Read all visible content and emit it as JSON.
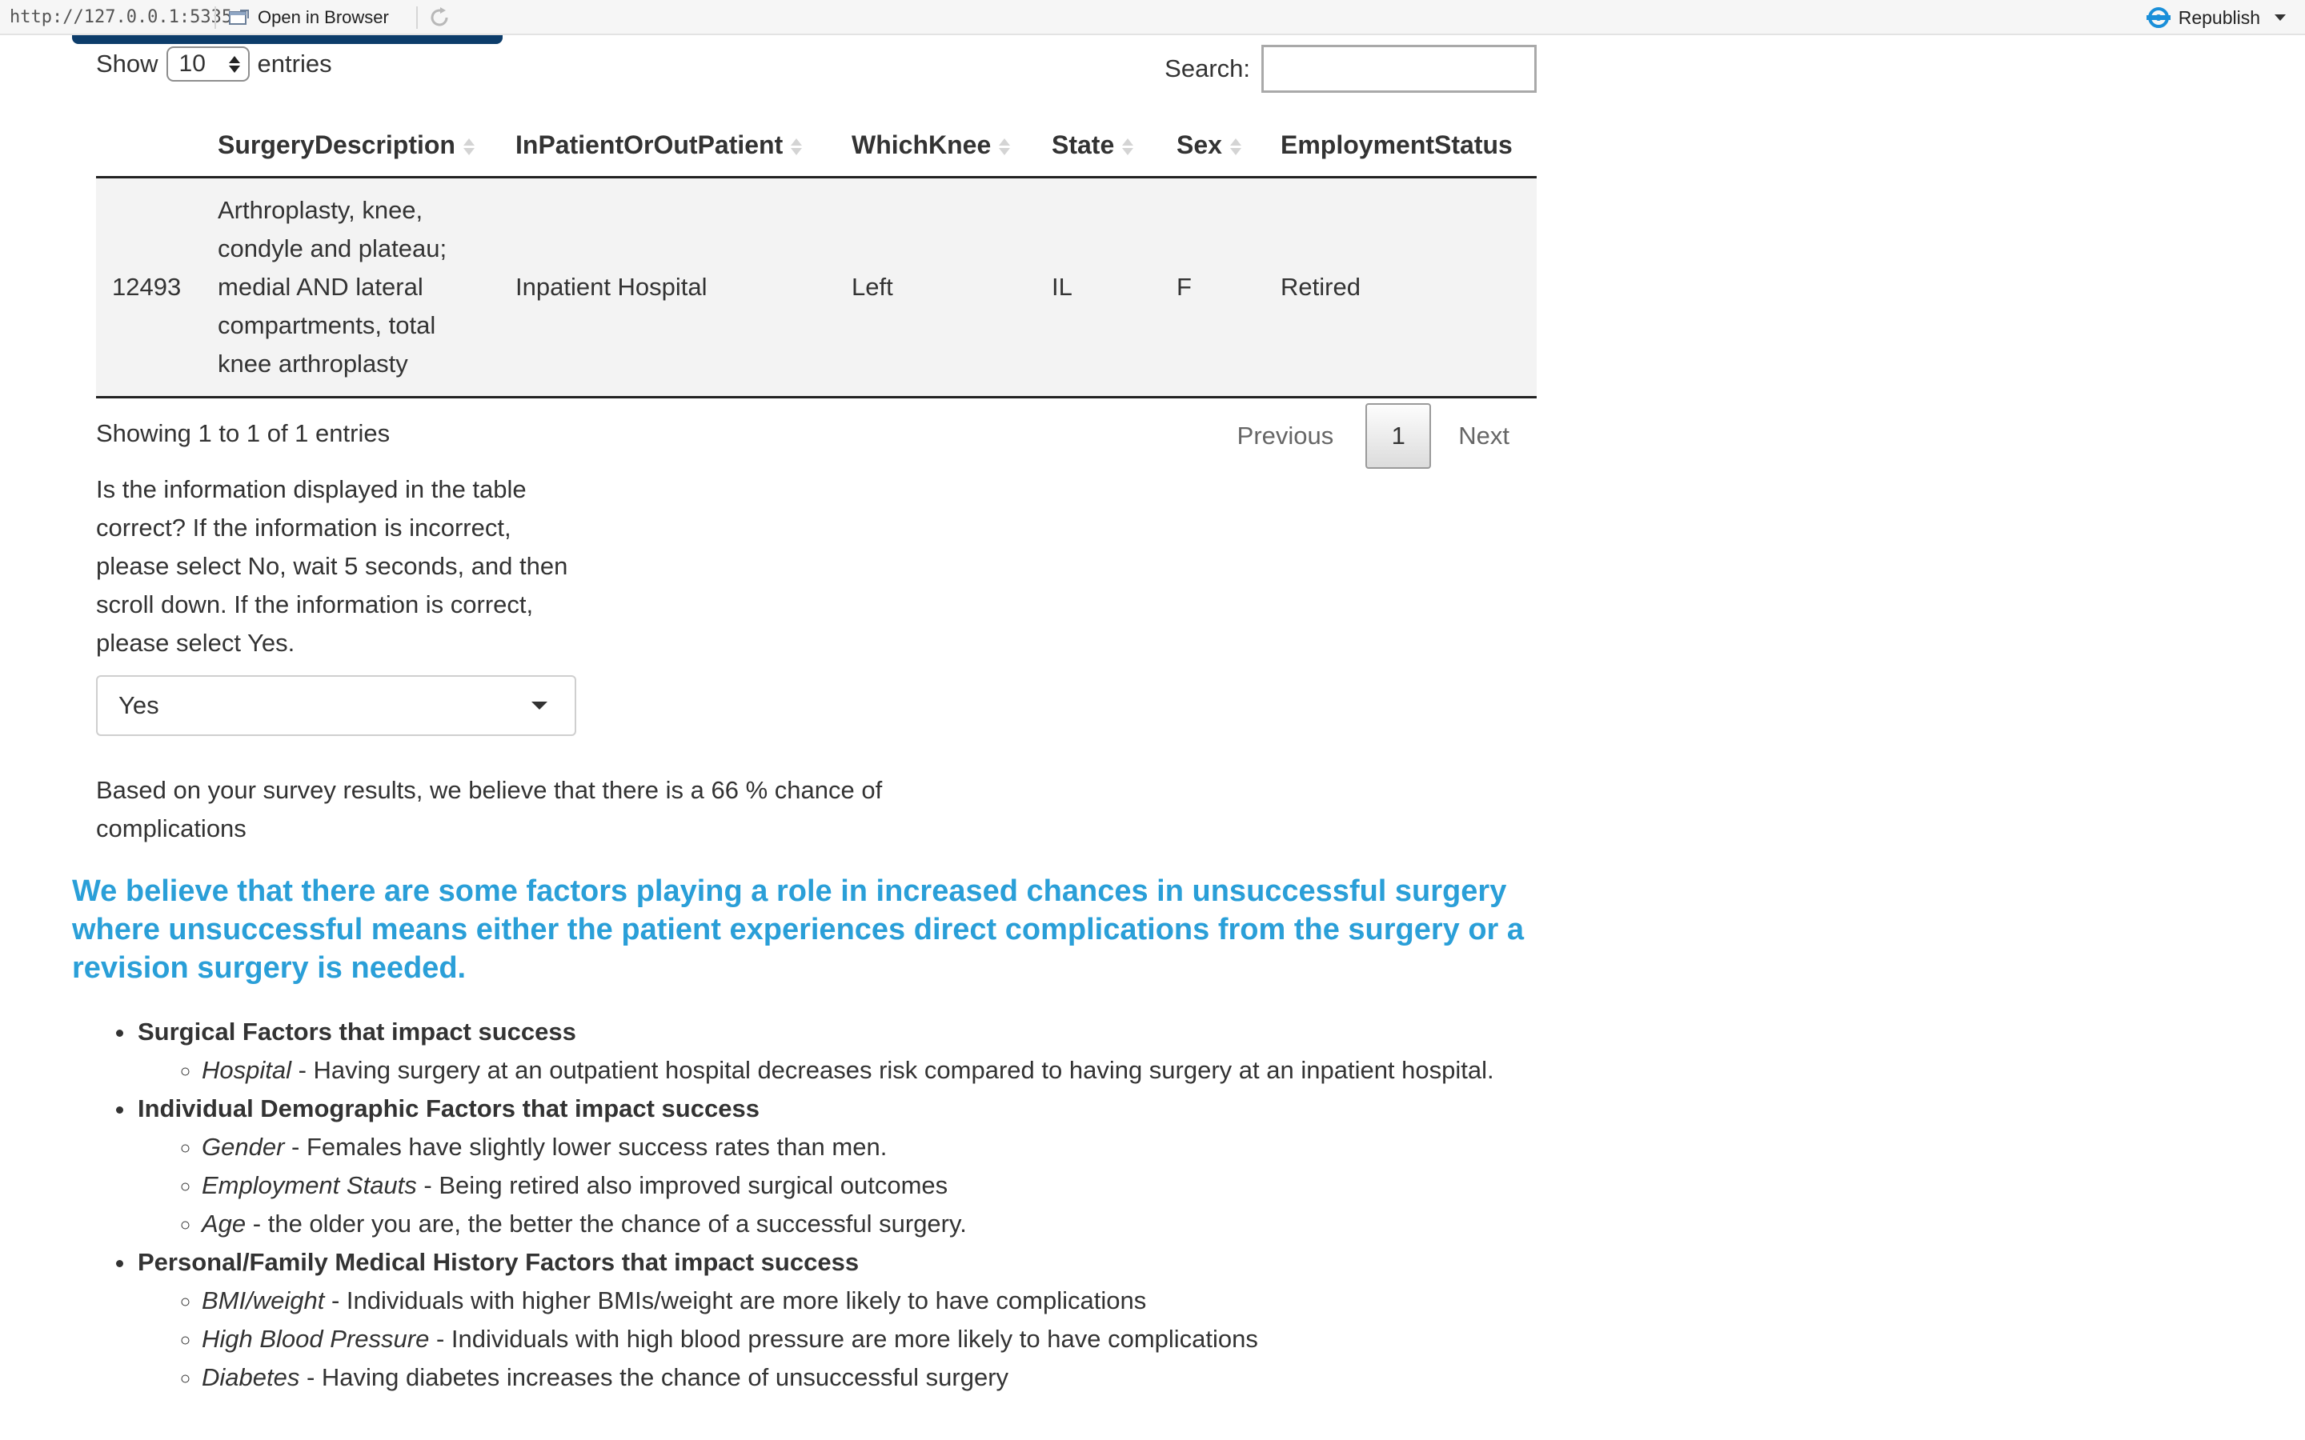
{
  "browser": {
    "url": "http://127.0.0.1:5335",
    "open_in_browser": "Open in Browser",
    "republish": "Republish"
  },
  "table_controls": {
    "show_label": "Show",
    "entries_value": "10",
    "entries_label": "entries",
    "search_label": "Search:",
    "search_value": ""
  },
  "table": {
    "columns": [
      "",
      "SurgeryDescription",
      "InPatientOrOutPatient",
      "WhichKnee",
      "State",
      "Sex",
      "EmploymentStatus"
    ],
    "rows": [
      [
        "12493",
        "Arthroplasty, knee, condyle and plateau; medial AND lateral compartments, total knee arthroplasty",
        "Inpatient Hospital",
        "Left",
        "IL",
        "F",
        "Retired"
      ]
    ],
    "info": "Showing 1 to 1 of 1 entries",
    "pagination": {
      "previous": "Previous",
      "current": "1",
      "next": "Next"
    }
  },
  "question": {
    "text": "Is the information displayed in the table correct? If the information is incorrect, please select No, wait 5 seconds, and then scroll down. If the information is correct, please select Yes.",
    "selected": "Yes"
  },
  "result_text": "Based on your survey results, we believe that there is a 66 % chance of complications",
  "headline": "We believe that there are some factors playing a role in increased chances in unsuccessful surgery where unsuccessful means either the patient experiences direct complications from the surgery or a revision surgery is needed.",
  "factors": [
    {
      "title": "Surgical Factors that impact success",
      "items": [
        {
          "term": "Hospital",
          "text": " - Having surgery at an outpatient hospital decreases risk compared to having surgery at an inpatient hospital."
        }
      ]
    },
    {
      "title": "Individual Demographic Factors that impact success",
      "items": [
        {
          "term": "Gender",
          "text": " - Females have slightly lower success rates than men."
        },
        {
          "term": "Employment Stauts",
          "text": " - Being retired also improved surgical outcomes"
        },
        {
          "term": "Age",
          "text": " - the older you are, the better the chance of a successful surgery."
        }
      ]
    },
    {
      "title": "Personal/Family Medical History Factors that impact success",
      "items": [
        {
          "term": "BMI/weight",
          "text": " - Individuals with higher BMIs/weight are more likely to have complications"
        },
        {
          "term": "High Blood Pressure",
          "text": " - Individuals with high blood pressure are more likely to have complications"
        },
        {
          "term": "Diabetes",
          "text": " - Having diabetes increases the chance of unsuccessful surgery"
        }
      ]
    }
  ],
  "colors": {
    "headline": "#2a9fd8",
    "accent_bar": "#0d3d6b",
    "publish_icon": "#1a8fd9"
  }
}
